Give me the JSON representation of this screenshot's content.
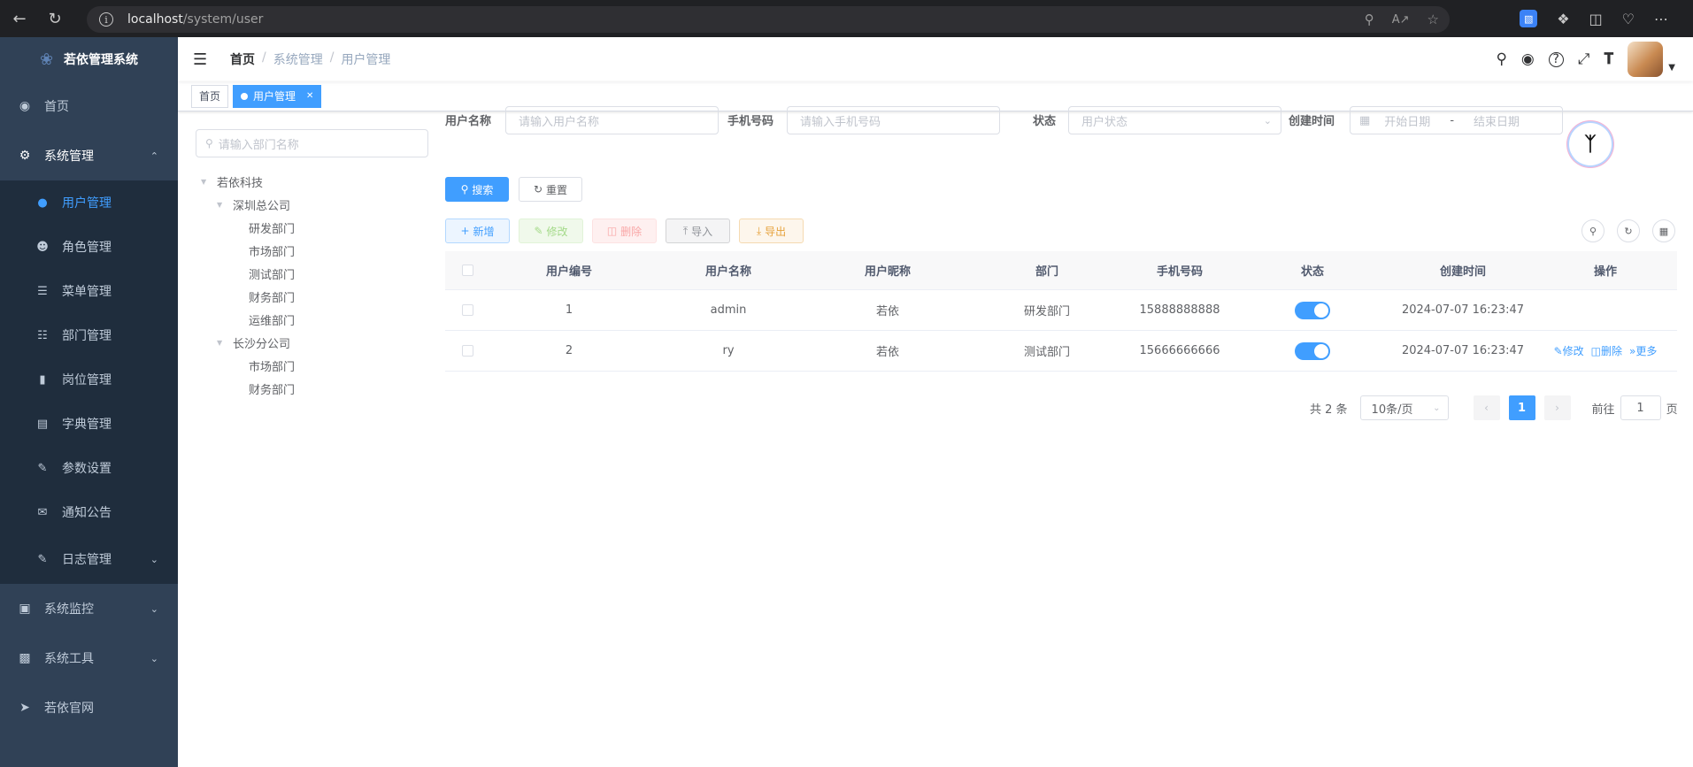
{
  "browser": {
    "url_host": "localhost",
    "url_path": "/system/user"
  },
  "sidebar": {
    "title": "若依管理系统",
    "items": [
      {
        "label": "首页",
        "icon": "dashboard-icon"
      },
      {
        "label": "系统管理",
        "icon": "gear-icon",
        "expanded": true
      },
      {
        "label": "系统监控",
        "icon": "monitor-icon"
      },
      {
        "label": "系统工具",
        "icon": "toolbox-icon"
      },
      {
        "label": "若依官网",
        "icon": "send-icon"
      }
    ],
    "submenu": [
      {
        "label": "用户管理",
        "icon": "user-icon",
        "active": true
      },
      {
        "label": "角色管理",
        "icon": "role-icon"
      },
      {
        "label": "菜单管理",
        "icon": "tree-table-icon"
      },
      {
        "label": "部门管理",
        "icon": "org-tree-icon"
      },
      {
        "label": "岗位管理",
        "icon": "post-icon"
      },
      {
        "label": "字典管理",
        "icon": "dict-icon"
      },
      {
        "label": "参数设置",
        "icon": "edit-icon"
      },
      {
        "label": "通知公告",
        "icon": "message-icon"
      },
      {
        "label": "日志管理",
        "icon": "log-icon"
      }
    ]
  },
  "navbar": {
    "breadcrumb": [
      "首页",
      "系统管理",
      "用户管理"
    ]
  },
  "tags": [
    {
      "label": "首页",
      "active": false
    },
    {
      "label": "用户管理",
      "active": true
    }
  ],
  "dept": {
    "search_placeholder": "请输入部门名称",
    "root": "若依科技",
    "branch1": "深圳总公司",
    "branch1_children": [
      "研发部门",
      "市场部门",
      "测试部门",
      "财务部门",
      "运维部门"
    ],
    "branch2": "长沙分公司",
    "branch2_children": [
      "市场部门",
      "财务部门"
    ]
  },
  "query": {
    "username_label": "用户名称",
    "username_placeholder": "请输入用户名称",
    "phone_label": "手机号码",
    "phone_placeholder": "请输入手机号码",
    "status_label": "状态",
    "status_placeholder": "用户状态",
    "time_label": "创建时间",
    "start_placeholder": "开始日期",
    "range_sep": "-",
    "end_placeholder": "结束日期",
    "search_btn": "搜索",
    "reset_btn": "重置"
  },
  "toolbar": {
    "add": "新增",
    "edit": "修改",
    "delete": "删除",
    "import": "导入",
    "export": "导出"
  },
  "table": {
    "headers": [
      "用户编号",
      "用户名称",
      "用户昵称",
      "部门",
      "手机号码",
      "状态",
      "创建时间",
      "操作"
    ],
    "rows": [
      {
        "id": "1",
        "username": "admin",
        "nickname": "若依",
        "dept": "研发部门",
        "phone": "15888888888",
        "status": true,
        "created": "2024-07-07 16:23:47"
      },
      {
        "id": "2",
        "username": "ry",
        "nickname": "若依",
        "dept": "测试部门",
        "phone": "15666666666",
        "status": true,
        "created": "2024-07-07 16:23:47",
        "ops": [
          "修改",
          "删除",
          "更多"
        ]
      }
    ]
  },
  "pagination": {
    "total_text": "共 2 条",
    "page_size": "10条/页",
    "current_page": "1",
    "goto_label": "前往",
    "goto_value": "1",
    "page_unit": "页"
  },
  "colors": {
    "primary": "#409eff",
    "sidebar_bg": "#304156",
    "submenu_bg": "#1f2d3d"
  }
}
